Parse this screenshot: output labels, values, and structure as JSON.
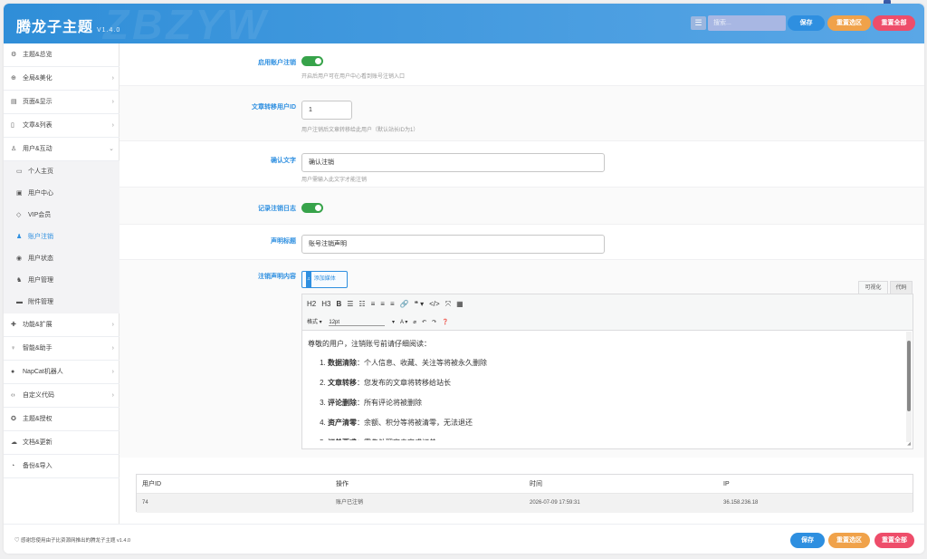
{
  "header": {
    "title": "腾龙子主题",
    "version": "V1.4.0",
    "watermark": "ZBZYW",
    "search_icon": "menu-search-icon",
    "search_placeholder": "搜索...",
    "buttons": {
      "save": "保存",
      "reset_section": "重置选区",
      "reset_all": "重置全部"
    }
  },
  "sidebar": {
    "items": [
      {
        "label": "主题&总览",
        "icon": "dashboard-icon",
        "glyph": "⚙",
        "has_children": false
      },
      {
        "label": "全局&美化",
        "icon": "globe-icon",
        "glyph": "⊕",
        "has_children": true
      },
      {
        "label": "页面&显示",
        "icon": "calendar-icon",
        "glyph": "▤",
        "has_children": true
      },
      {
        "label": "文章&列表",
        "icon": "book-icon",
        "glyph": "▯",
        "has_children": true
      },
      {
        "label": "用户&互动",
        "icon": "user-icon",
        "glyph": "♙",
        "has_children": true,
        "expanded": true
      }
    ],
    "sub_items": [
      {
        "label": "个人主页",
        "icon": "id-card-icon",
        "glyph": "▭",
        "active": false
      },
      {
        "label": "用户中心",
        "icon": "user-square-icon",
        "glyph": "▣",
        "active": false
      },
      {
        "label": "VIP会员",
        "icon": "diamond-icon",
        "glyph": "◇",
        "active": false
      },
      {
        "label": "账户注销",
        "icon": "user-minus-icon",
        "glyph": "♟",
        "active": true
      },
      {
        "label": "用户状态",
        "icon": "user-circle-icon",
        "glyph": "◉",
        "active": false
      },
      {
        "label": "用户管理",
        "icon": "users-icon",
        "glyph": "♞",
        "active": false
      },
      {
        "label": "附件管理",
        "icon": "folder-icon",
        "glyph": "▬",
        "active": false
      }
    ],
    "items_after": [
      {
        "label": "功能&扩展",
        "icon": "puzzle-icon",
        "glyph": "✚",
        "has_children": true
      },
      {
        "label": "智能&助手",
        "icon": "lightbulb-icon",
        "glyph": "♀",
        "has_children": true
      },
      {
        "label": "NapCat机器人",
        "icon": "robot-icon",
        "glyph": "●",
        "has_children": true
      },
      {
        "label": "自定义代码",
        "icon": "code-icon",
        "glyph": "‹›",
        "has_children": true
      },
      {
        "label": "主题&授权",
        "icon": "license-icon",
        "glyph": "✪",
        "has_children": false
      },
      {
        "label": "文档&更新",
        "icon": "cloud-icon",
        "glyph": "☁",
        "has_children": false
      },
      {
        "label": "备份&导入",
        "icon": "backup-icon",
        "glyph": "◔",
        "has_children": false
      }
    ]
  },
  "settings": {
    "enable_deactivation": {
      "label": "启用账户注销",
      "desc": "开启后用户可在用户中心看到账号注销入口",
      "on": true
    },
    "transfer_user": {
      "label": "文章转移用户ID",
      "value": "1",
      "desc": "用户注销后文章转移给此用户（默认站长ID为1）"
    },
    "confirm_text": {
      "label": "确认文字",
      "value": "确认注销",
      "desc": "用户需输入此文字才能注销"
    },
    "log_toggle": {
      "label": "记录注销日志",
      "on": true
    },
    "notice_title": {
      "label": "声明标题",
      "value": "账号注销声明"
    },
    "notice_content": {
      "label": "注销声明内容",
      "add_media": "添加媒体",
      "tab_visual": "可视化",
      "tab_code": "代码",
      "toolbar_row1": [
        "H2",
        "H3",
        "B",
        "☰",
        "☷",
        "≡",
        "≡",
        "≡",
        "🔗",
        "❝ ▾",
        "</>",
        "⤧",
        "▦"
      ],
      "toolbar_row2_format": "格式 ▾",
      "toolbar_row2_size": "12pt",
      "toolbar_row2_rest": [
        "▾",
        "A ▾",
        "⌀",
        "↶",
        "↷",
        "❓"
      ],
      "intro": "尊敬的用户，注销账号前请仔细阅读：",
      "list": [
        {
          "bold": "数据清除",
          "text": "：个人信息、收藏、关注等将被永久删除"
        },
        {
          "bold": "文章转移",
          "text": "：您发布的文章将转移给站长"
        },
        {
          "bold": "评论删除",
          "text": "：所有评论将被删除"
        },
        {
          "bold": "资产清零",
          "text": "：余额、积分等将被清零，无法退还"
        },
        {
          "bold": "订单要求",
          "text": "：需先处理完未完成订单"
        }
      ]
    }
  },
  "log_table": {
    "columns": [
      "用户ID",
      "操作",
      "时间",
      "IP"
    ],
    "rows": [
      [
        "74",
        "账户已注销",
        "2026-07-09 17:59:31",
        "36.158.236.18"
      ]
    ]
  },
  "footer": {
    "text": "感谢您使用由子比资源网推出的腾龙子主题 v1.4.0",
    "heart_icon": "heart-icon",
    "buttons": {
      "save": "保存",
      "reset_section": "重置选区",
      "reset_all": "重置全部"
    }
  },
  "colors": {
    "accent": "#2e8fe0",
    "toggle_on": "#37a34a",
    "reset_section": "#f0a24a",
    "reset_all": "#ee4d6a"
  }
}
